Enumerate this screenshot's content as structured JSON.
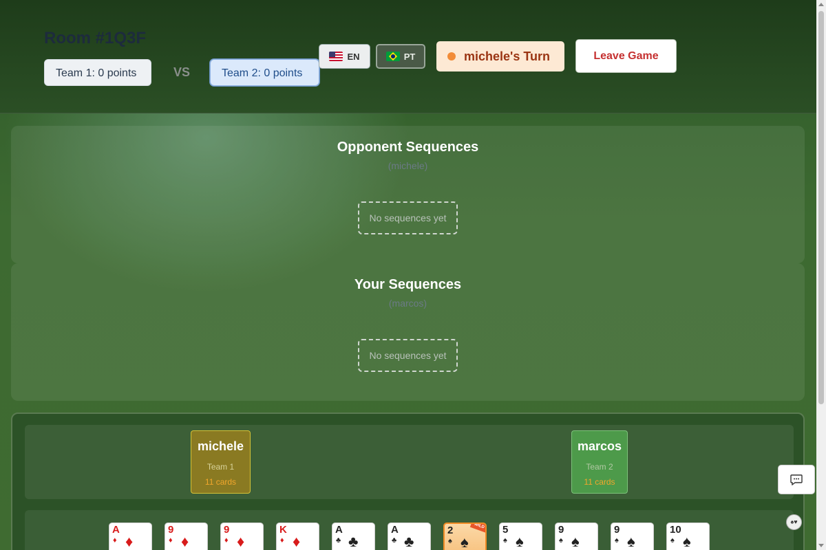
{
  "header": {
    "room_title": "Room #1Q3F",
    "team1_label": "Team 1: 0 points",
    "vs_label": "VS",
    "team2_label": "Team 2: 0 points",
    "lang_en": "EN",
    "lang_pt": "PT",
    "turn_label": "michele's Turn",
    "leave_label": "Leave Game"
  },
  "sequences": {
    "opponent": {
      "title": "Opponent Sequences",
      "player": "(michele)",
      "empty": "No sequences yet"
    },
    "yours": {
      "title": "Your Sequences",
      "player": "(marcos)",
      "empty": "No sequences yet"
    }
  },
  "players": [
    {
      "name": "michele",
      "team": "Team 1",
      "cards": "11 cards"
    },
    {
      "name": "marcos",
      "team": "Team 2",
      "cards": "11 cards"
    }
  ],
  "hand": [
    {
      "rank": "A",
      "suit": "♦",
      "color": "red"
    },
    {
      "rank": "9",
      "suit": "♦",
      "color": "red"
    },
    {
      "rank": "9",
      "suit": "♦",
      "color": "red"
    },
    {
      "rank": "K",
      "suit": "♦",
      "color": "red"
    },
    {
      "rank": "A",
      "suit": "♣",
      "color": "black"
    },
    {
      "rank": "A",
      "suit": "♣",
      "color": "black"
    },
    {
      "rank": "2",
      "suit": "♠",
      "color": "black",
      "wild": "WILD"
    },
    {
      "rank": "5",
      "suit": "♠",
      "color": "black"
    },
    {
      "rank": "9",
      "suit": "♠",
      "color": "black"
    },
    {
      "rank": "9",
      "suit": "♠",
      "color": "black"
    },
    {
      "rank": "10",
      "suit": "♠",
      "color": "black"
    }
  ],
  "sort_icon": "♠♥",
  "colors": {
    "accent_turn": "#f28c38",
    "leave": "#c53030",
    "table": "#2c5227"
  }
}
